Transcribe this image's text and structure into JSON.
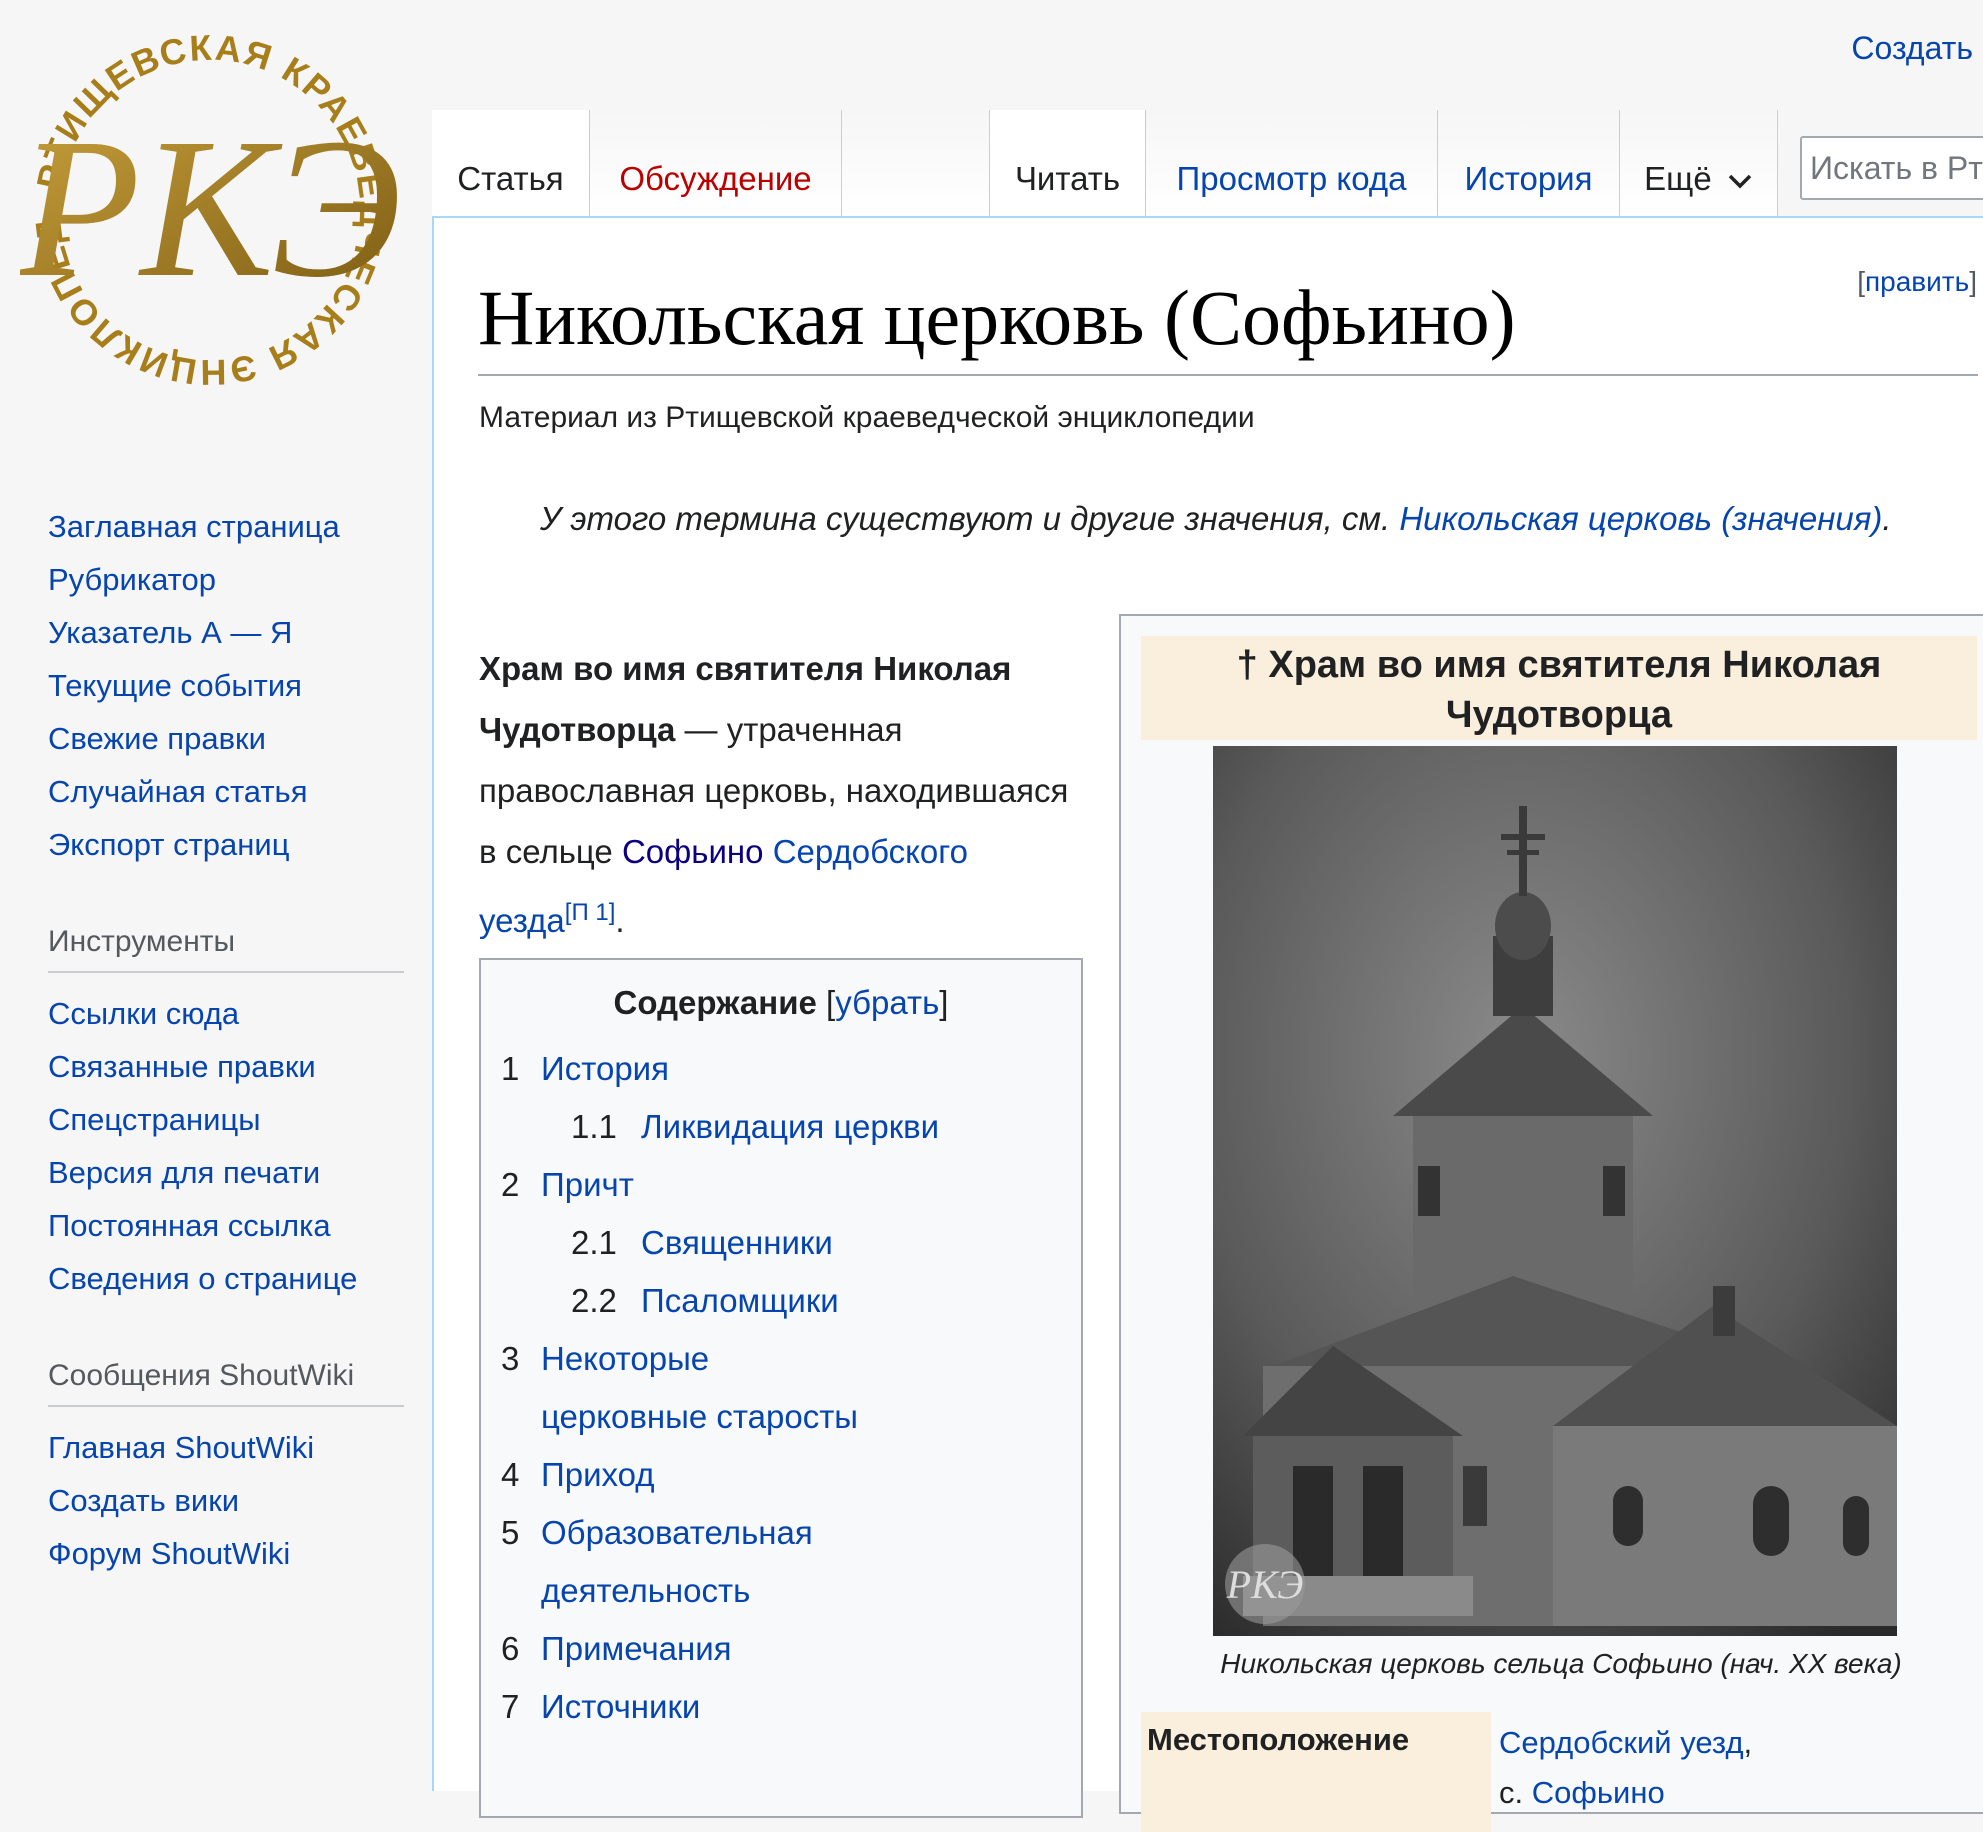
{
  "personal": {
    "create_account": "Создать"
  },
  "logo": {
    "text": "РТИЩЕВСКАЯ КРАЕВЕДЧЕСКАЯ ЭНЦИКЛОПЕДИЯ",
    "monogram": "РКЭ"
  },
  "tabs": {
    "article": "Статья",
    "talk": "Обсуждение",
    "read": "Читать",
    "view_source": "Просмотр кода",
    "history": "История",
    "more": "Ещё"
  },
  "search": {
    "placeholder": "Искать в Ртищевской"
  },
  "sidebar": {
    "navigation": [
      "Заглавная страница",
      "Рубрикатор",
      "Указатель А — Я",
      "Текущие события",
      "Свежие правки",
      "Случайная статья",
      "Экспорт страниц"
    ],
    "tools_heading": "Инструменты",
    "tools": [
      "Ссылки сюда",
      "Связанные правки",
      "Спецстраницы",
      "Версия для печати",
      "Постоянная ссылка",
      "Сведения о странице"
    ],
    "shoutwiki_heading": "Сообщения ShoutWiki",
    "shoutwiki": [
      "Главная ShoutWiki",
      "Создать вики",
      "Форум ShoutWiki"
    ]
  },
  "article": {
    "title": "Никольская церковь (Софьино)",
    "edit_link": "править",
    "site_sub": "Материал из Ртищевской краеведческой энциклопедии",
    "hatnote_text": "У этого термина существуют и другие значения, см. ",
    "hatnote_link": "Никольская церковь (значения)",
    "lead_bold": "Храм во имя святителя Николая Чудотворца",
    "lead_dash": " — утраченная православная церковь, находившаяся в сельце ",
    "lead_link1": "Софьино",
    "lead_link2": "Сердобского уезда",
    "lead_ref": "[П 1]"
  },
  "toc": {
    "title": "Содержание",
    "toggle": "убрать",
    "items": [
      {
        "num": "1",
        "label": "История",
        "level": 1
      },
      {
        "num": "1.1",
        "label": "Ликвидация церкви",
        "level": 2
      },
      {
        "num": "2",
        "label": "Причт",
        "level": 1
      },
      {
        "num": "2.1",
        "label": "Священники",
        "level": 2
      },
      {
        "num": "2.2",
        "label": "Псаломщики",
        "level": 2
      },
      {
        "num": "3",
        "label": "Некоторые церковные старосты",
        "level": 1
      },
      {
        "num": "4",
        "label": "Приход",
        "level": 1
      },
      {
        "num": "5",
        "label": "Образовательная деятельность",
        "level": 1
      },
      {
        "num": "6",
        "label": "Примечания",
        "level": 1
      },
      {
        "num": "7",
        "label": "Источники",
        "level": 1
      }
    ]
  },
  "infobox": {
    "title": "† Храм во имя святителя Николая Чудотворца",
    "caption": "Никольская церковь сельца Софьино (нач. XX века)",
    "location_label": "Местоположение",
    "location_link1": "Сердобский уезд",
    "location_prefix2": "с. ",
    "location_link2": "Софьино"
  }
}
